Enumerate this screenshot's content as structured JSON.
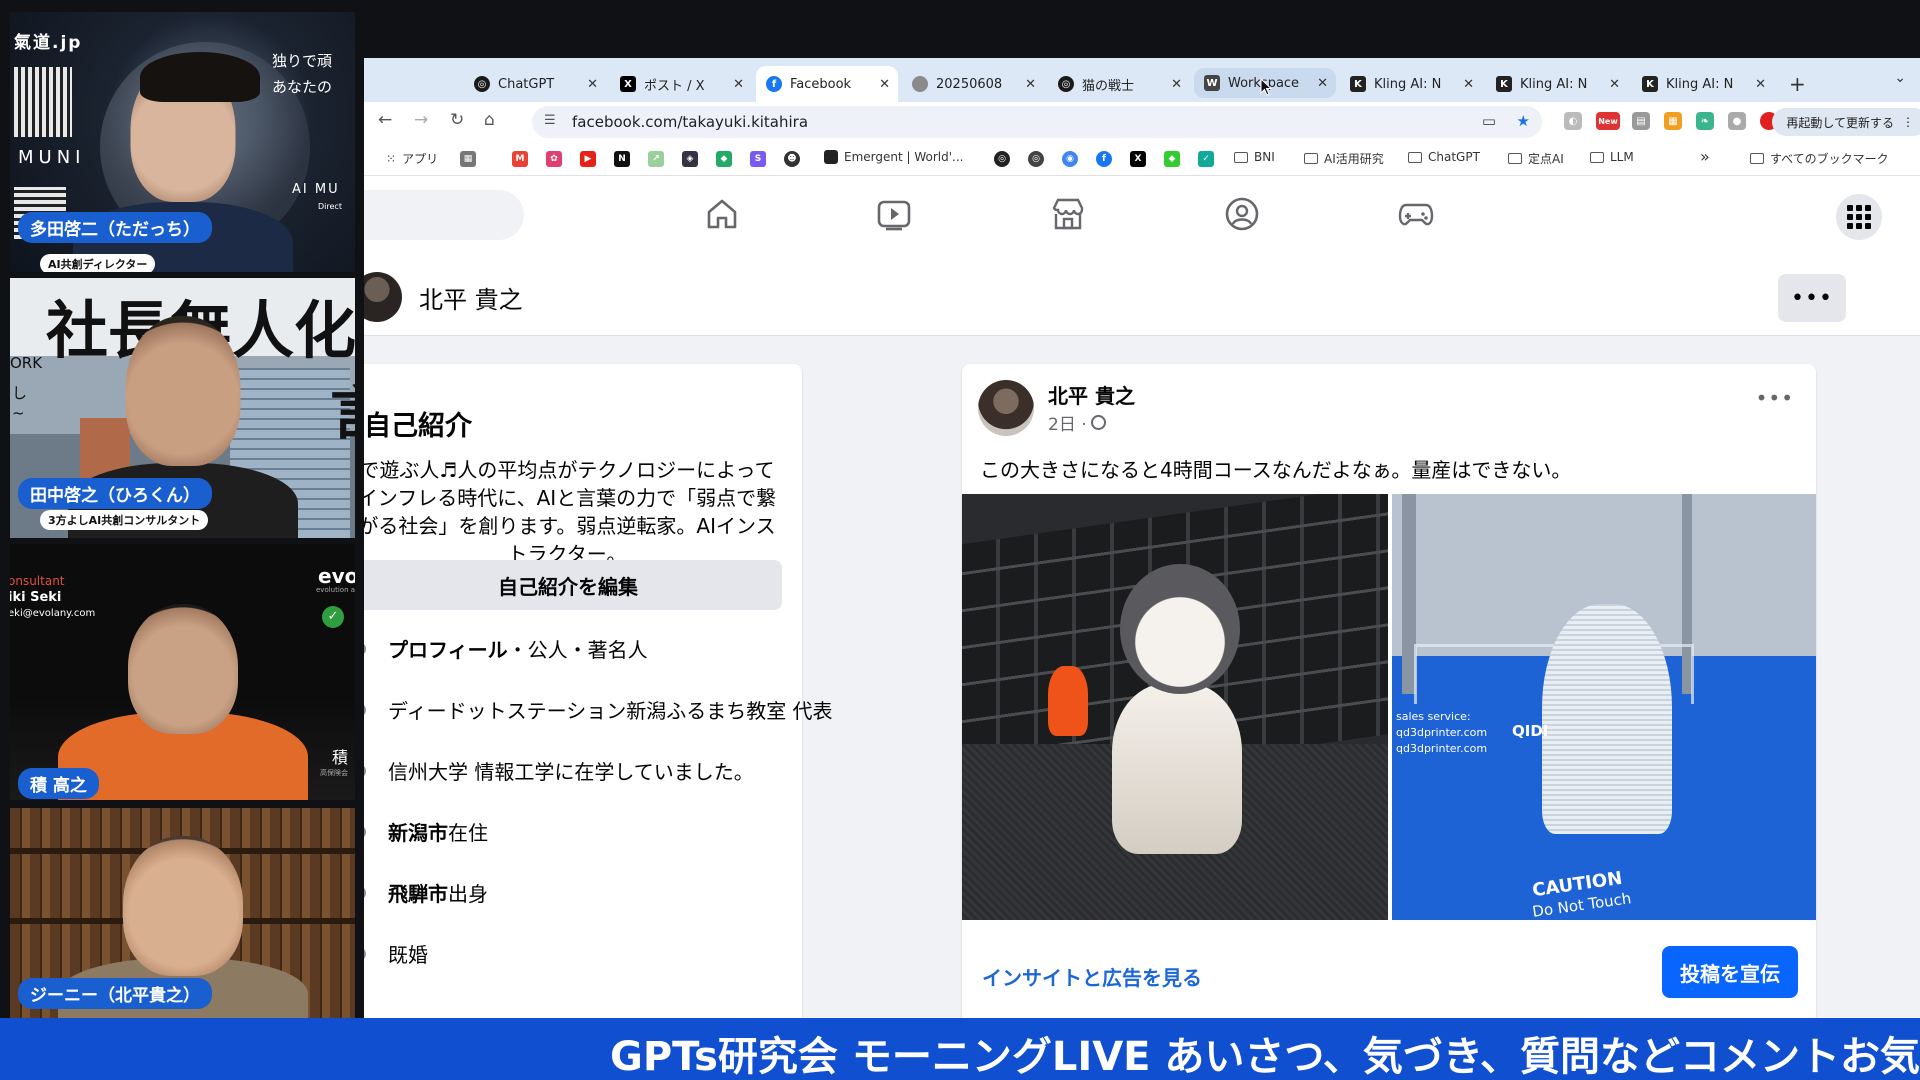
{
  "participants": [
    {
      "name": "多田啓二（ただっち）",
      "subtitle": "AI共創ディレクター",
      "overlay_texts": [
        "氣道.jp",
        "独りで頑",
        "あなたの",
        "MUNI",
        "AI MU",
        "Direct"
      ]
    },
    {
      "name": "田中啓之（ひろくん）",
      "subtitle": "3方よしAI共創コンサルタント",
      "overlay_texts": [
        "社長無人化",
        "ORK",
        "し",
        "~",
        "言"
      ]
    },
    {
      "name": "積 高之",
      "subtitle": "",
      "overlay_texts": [
        "onsultant",
        "iki Seki",
        "eki@evolany.com",
        "evo",
        "evolution a",
        "積",
        "高保険会"
      ]
    },
    {
      "name": "ジーニー（北平貴之）",
      "subtitle": "",
      "overlay_texts": []
    }
  ],
  "browser": {
    "tabs": [
      {
        "label": "ChatGPT",
        "icon": "chatgpt-icon",
        "color": "#1a1a1a"
      },
      {
        "label": "ポスト / X",
        "icon": "x-icon",
        "color": "#000000"
      },
      {
        "label": "Facebook",
        "icon": "facebook-icon",
        "color": "#1877f2"
      },
      {
        "label": "20250608",
        "icon": "apple-icon",
        "color": "#666666"
      },
      {
        "label": "猫の戦士",
        "icon": "chatgpt-icon",
        "color": "#1a1a1a"
      },
      {
        "label": "Workspace",
        "icon": "workspace-icon",
        "color": "#444444"
      },
      {
        "label": "Kling AI: N",
        "icon": "kling-icon",
        "color": "#222222"
      },
      {
        "label": "Kling AI: N",
        "icon": "kling-icon",
        "color": "#222222"
      },
      {
        "label": "Kling AI: N",
        "icon": "kling-icon",
        "color": "#222222"
      }
    ],
    "active_tab_index": 2,
    "hover_tab_index": 5,
    "url": "facebook.com/takayuki.kitahira",
    "new_badge": "New",
    "restart_label": "再起動して更新する",
    "bookmarks": [
      {
        "label": "アプリ",
        "type": "apps"
      },
      {
        "label": "Emergent | World'...",
        "type": "site"
      },
      {
        "label": "BNI",
        "type": "folder"
      },
      {
        "label": "AI活用研究",
        "type": "folder"
      },
      {
        "label": "ChatGPT",
        "type": "folder"
      },
      {
        "label": "定点AI",
        "type": "folder"
      },
      {
        "label": "LLM",
        "type": "folder"
      }
    ],
    "bookmarks_overflow": "»",
    "all_bookmarks_label": "すべてのブックマーク"
  },
  "facebook": {
    "profile_name": "北平 貴之",
    "more_label": "•••",
    "intro": {
      "title": "自己紹介",
      "bio": "で遊ぶ人♬人の平均点がテクノロジーによってインフレる時代に、AIと言葉の力で「弱点で繋がる社会」を創ります。弱点逆転家。AIインストラクター。",
      "edit_label": "自己紹介を編集",
      "details": [
        {
          "bold": "プロフィール",
          "rest": "・公人・著名人"
        },
        {
          "bold": "",
          "rest": "ディードットステーション新潟ふるまち教室 代表"
        },
        {
          "bold": "",
          "rest": "信州大学 情報工学に在学していました。"
        },
        {
          "bold": "新潟市",
          "rest": "在住"
        },
        {
          "bold": "飛騨市",
          "rest": "出身"
        },
        {
          "bold": "",
          "rest": "既婚"
        }
      ]
    },
    "post": {
      "author": "北平 貴之",
      "time": "2日 ·",
      "text": "この大きさになると4時間コースなんだよなぁ。量産はできない。",
      "more_label": "•••",
      "insight_label": "インサイトと広告を見る",
      "promote_label": "投稿を宣伝",
      "photo2_texts": [
        "sales service:",
        "qd3dprinter.com",
        "qd3dprinter.com",
        "QIDI",
        "CAUTION",
        "Do Not Touch"
      ]
    }
  },
  "ticker": "GPTs研究会 モーニングLIVE あいさつ、気づき、質問などコメントお気軽に",
  "colors": {
    "name_pill": "#1a5fd0",
    "ticker_bg": "#0f4fd0",
    "fb_blue": "#0866ff",
    "tab_strip": "#dde8f6"
  }
}
